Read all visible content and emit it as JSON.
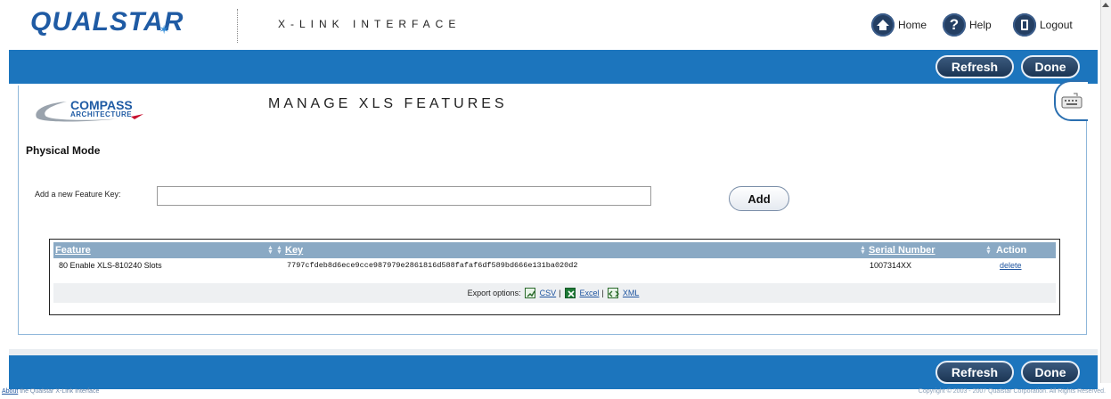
{
  "header": {
    "logo_text": "QUALSTAR",
    "app_title": "X-LINK INTERFACE",
    "links": {
      "home": "Home",
      "help": "Help",
      "logout": "Logout"
    }
  },
  "toolbar": {
    "refresh_label": "Refresh",
    "done_label": "Done"
  },
  "page": {
    "compass_line1": "COMPASS",
    "compass_line2": "ARCHITECTURE",
    "title": "MANAGE XLS FEATURES",
    "section_title": "Physical Mode",
    "feature_key_label": "Add a new Feature Key:",
    "feature_key_value": "",
    "add_label": "Add"
  },
  "table": {
    "columns": [
      "Feature",
      "Key",
      "Serial Number",
      "Action"
    ],
    "rows": [
      {
        "feature": "80 Enable XLS-810240 Slots",
        "key": "7797cfdeb8d6ece9cce987979e2861816d588fafaf6df589bd666e131ba020d2",
        "serial": "1007314XX",
        "action": "delete"
      }
    ],
    "export": {
      "label": "Export options:",
      "csv": "CSV",
      "excel": "Excel",
      "xml": "XML"
    }
  },
  "footer": {
    "about_link": "About",
    "about_rest": " the Qualstar X-Link Interface",
    "copyright": "Copyright © 2003 - 2007 Qualstar Corporation. All Rights Reserved."
  },
  "colors": {
    "bar_blue": "#1c75bd",
    "button_navy": "#1b3553",
    "grid_header": "#8aa9c4",
    "logo_blue": "#1f5ba4"
  }
}
